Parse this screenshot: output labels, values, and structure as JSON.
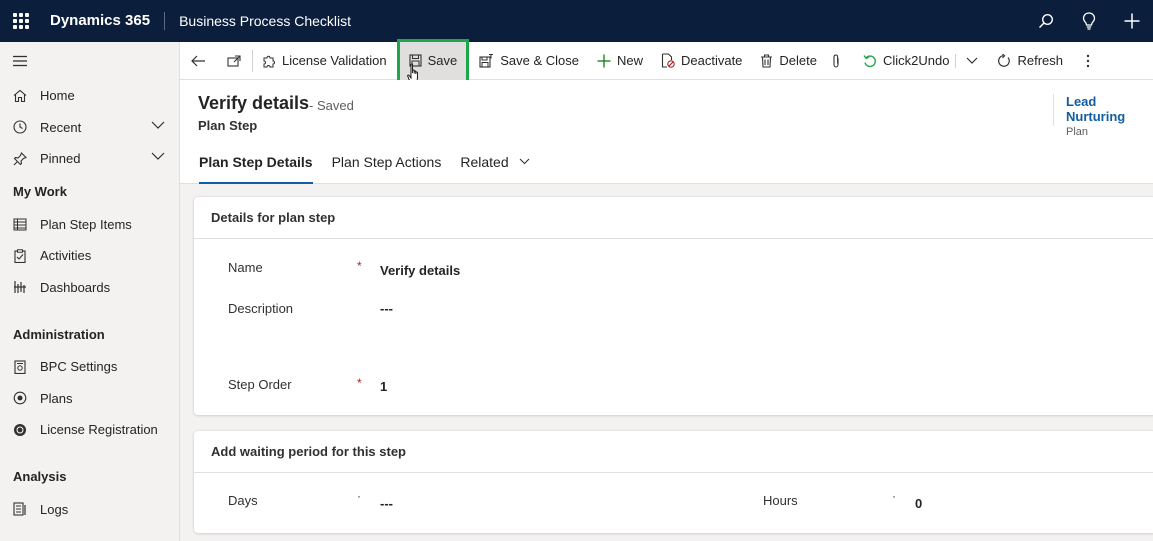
{
  "topbar": {
    "brand": "Dynamics 365",
    "app_name": "Business Process Checklist",
    "icons": [
      "search-icon",
      "lightbulb-icon",
      "plus-icon"
    ]
  },
  "sidebar": {
    "items_top": [
      {
        "label": "Home",
        "icon": "home-icon"
      },
      {
        "label": "Recent",
        "icon": "clock-icon",
        "expandable": true
      },
      {
        "label": "Pinned",
        "icon": "pin-icon",
        "expandable": true
      }
    ],
    "sections": [
      {
        "title": "My Work",
        "items": [
          {
            "label": "Plan Step Items",
            "icon": "checklist-icon"
          },
          {
            "label": "Activities",
            "icon": "clipboard-icon"
          },
          {
            "label": "Dashboards",
            "icon": "dashboard-icon"
          }
        ]
      },
      {
        "title": "Administration",
        "items": [
          {
            "label": "BPC Settings",
            "icon": "settings-doc-icon"
          },
          {
            "label": "Plans",
            "icon": "target-icon"
          },
          {
            "label": "License Registration",
            "icon": "seal-icon"
          }
        ]
      },
      {
        "title": "Analysis",
        "items": [
          {
            "label": "Logs",
            "icon": "logs-icon"
          }
        ]
      }
    ]
  },
  "commandbar": {
    "license_validation": "License Validation",
    "save": "Save",
    "save_close": "Save & Close",
    "new": "New",
    "deactivate": "Deactivate",
    "delete": "Delete",
    "click2undo": "Click2Undo",
    "refresh": "Refresh"
  },
  "record": {
    "title": "Verify details",
    "saved_status": "- Saved",
    "entity": "Plan Step",
    "bpf_title": "Lead Nurturing",
    "bpf_sub": "Plan"
  },
  "tabs": [
    {
      "label": "Plan Step Details",
      "active": true
    },
    {
      "label": "Plan Step Actions",
      "active": false
    },
    {
      "label": "Related",
      "active": false
    }
  ],
  "section_details": {
    "title": "Details for plan step",
    "name_label": "Name",
    "name_value": "Verify details",
    "description_label": "Description",
    "description_value": "---",
    "step_order_label": "Step Order",
    "step_order_value": "1",
    "required_marker": "*"
  },
  "section_waiting": {
    "title": "Add waiting period for this step",
    "days_label": "Days",
    "days_value": "---",
    "hours_label": "Hours",
    "hours_value": "0"
  },
  "colors": {
    "topbar": "#0b1e3c",
    "save_highlight": "#1ea64a",
    "link": "#115ea3",
    "required": "#a4262c"
  }
}
